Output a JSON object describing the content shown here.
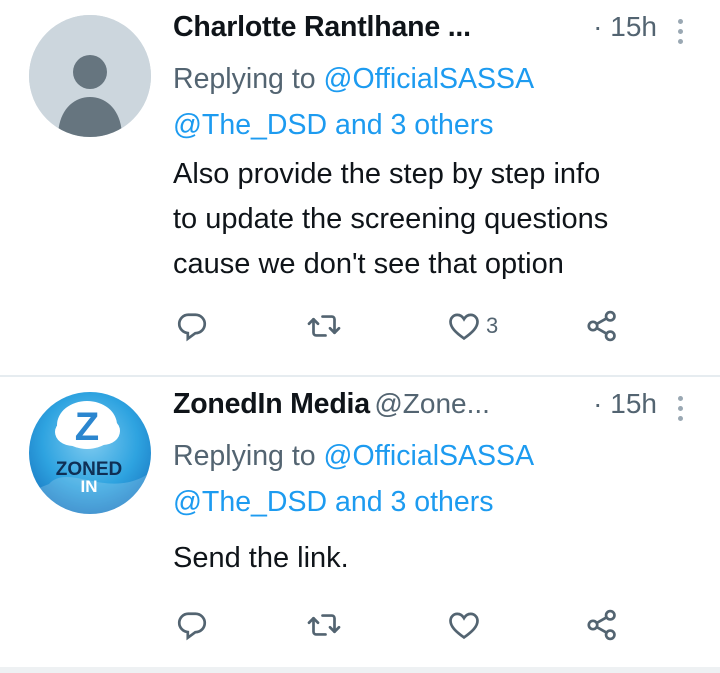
{
  "tweets": [
    {
      "name": "Charlotte Rantlhane ...",
      "handle": "",
      "time": "· 15h",
      "replying_prefix": "Replying to",
      "reply_to_1": "@OfficialSASSA",
      "reply_to_2": "@The_DSD",
      "reply_and": "and",
      "reply_others": "3 others",
      "text_lines": [
        "Also provide the step by step info",
        "to update the screening questions",
        "cause we don't see that option"
      ],
      "like_count": "3",
      "avatar": "default-avatar-icon"
    },
    {
      "name": "ZonedIn Media",
      "handle": "@Zone...",
      "time": "· 15h",
      "replying_prefix": "Replying to",
      "reply_to_1": "@OfficialSASSA",
      "reply_to_2": "@The_DSD",
      "reply_and": "and",
      "reply_others": "3 others",
      "text_lines": [
        "Send the link."
      ],
      "like_count": "",
      "avatar": "zonedin-logo",
      "logo_letter": "Z",
      "logo_text_1": "ZONED",
      "logo_text_2": "IN"
    }
  ],
  "icons": [
    "reply-icon",
    "retweet-icon",
    "like-icon",
    "share-icon",
    "more-icon"
  ],
  "colors": {
    "link": "#1d9bf0",
    "secondary": "#536471",
    "text": "#0f1419",
    "icon": "#536471"
  }
}
